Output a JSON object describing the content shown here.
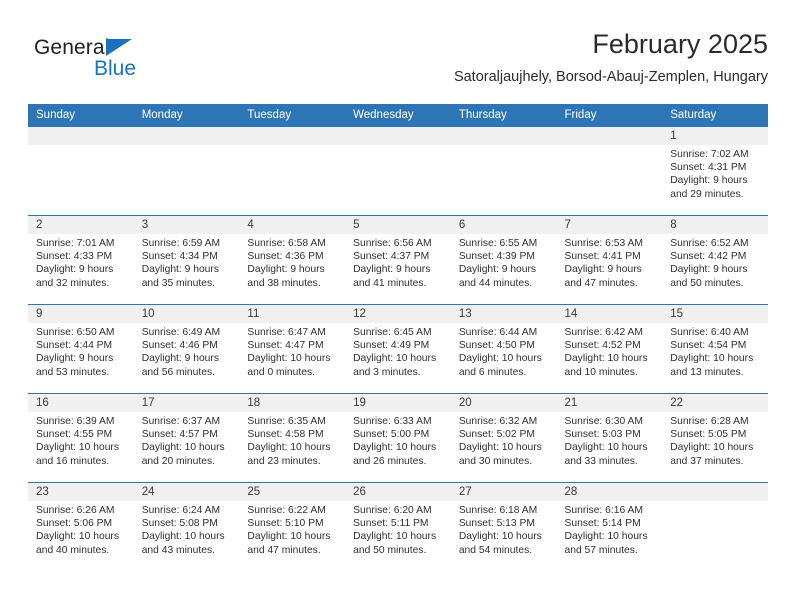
{
  "logo": {
    "word_one": "General",
    "word_two": "Blue",
    "triangle_icon": "triangle-icon",
    "brand_color": "#1a72bb"
  },
  "header": {
    "title": "February 2025",
    "subtitle": "Satoraljaujhely, Borsod-Abauj-Zemplen, Hungary"
  },
  "colors": {
    "header_blue": "#2e75b6",
    "daynum_gray": "#f0f0f0",
    "text": "#303030"
  },
  "weekdays": [
    "Sunday",
    "Monday",
    "Tuesday",
    "Wednesday",
    "Thursday",
    "Friday",
    "Saturday"
  ],
  "weeks": [
    [
      {
        "day": "",
        "sunrise": "",
        "sunset": "",
        "daylight1": "",
        "daylight2": ""
      },
      {
        "day": "",
        "sunrise": "",
        "sunset": "",
        "daylight1": "",
        "daylight2": ""
      },
      {
        "day": "",
        "sunrise": "",
        "sunset": "",
        "daylight1": "",
        "daylight2": ""
      },
      {
        "day": "",
        "sunrise": "",
        "sunset": "",
        "daylight1": "",
        "daylight2": ""
      },
      {
        "day": "",
        "sunrise": "",
        "sunset": "",
        "daylight1": "",
        "daylight2": ""
      },
      {
        "day": "",
        "sunrise": "",
        "sunset": "",
        "daylight1": "",
        "daylight2": ""
      },
      {
        "day": "1",
        "sunrise": "Sunrise: 7:02 AM",
        "sunset": "Sunset: 4:31 PM",
        "daylight1": "Daylight: 9 hours",
        "daylight2": "and 29 minutes."
      }
    ],
    [
      {
        "day": "2",
        "sunrise": "Sunrise: 7:01 AM",
        "sunset": "Sunset: 4:33 PM",
        "daylight1": "Daylight: 9 hours",
        "daylight2": "and 32 minutes."
      },
      {
        "day": "3",
        "sunrise": "Sunrise: 6:59 AM",
        "sunset": "Sunset: 4:34 PM",
        "daylight1": "Daylight: 9 hours",
        "daylight2": "and 35 minutes."
      },
      {
        "day": "4",
        "sunrise": "Sunrise: 6:58 AM",
        "sunset": "Sunset: 4:36 PM",
        "daylight1": "Daylight: 9 hours",
        "daylight2": "and 38 minutes."
      },
      {
        "day": "5",
        "sunrise": "Sunrise: 6:56 AM",
        "sunset": "Sunset: 4:37 PM",
        "daylight1": "Daylight: 9 hours",
        "daylight2": "and 41 minutes."
      },
      {
        "day": "6",
        "sunrise": "Sunrise: 6:55 AM",
        "sunset": "Sunset: 4:39 PM",
        "daylight1": "Daylight: 9 hours",
        "daylight2": "and 44 minutes."
      },
      {
        "day": "7",
        "sunrise": "Sunrise: 6:53 AM",
        "sunset": "Sunset: 4:41 PM",
        "daylight1": "Daylight: 9 hours",
        "daylight2": "and 47 minutes."
      },
      {
        "day": "8",
        "sunrise": "Sunrise: 6:52 AM",
        "sunset": "Sunset: 4:42 PM",
        "daylight1": "Daylight: 9 hours",
        "daylight2": "and 50 minutes."
      }
    ],
    [
      {
        "day": "9",
        "sunrise": "Sunrise: 6:50 AM",
        "sunset": "Sunset: 4:44 PM",
        "daylight1": "Daylight: 9 hours",
        "daylight2": "and 53 minutes."
      },
      {
        "day": "10",
        "sunrise": "Sunrise: 6:49 AM",
        "sunset": "Sunset: 4:46 PM",
        "daylight1": "Daylight: 9 hours",
        "daylight2": "and 56 minutes."
      },
      {
        "day": "11",
        "sunrise": "Sunrise: 6:47 AM",
        "sunset": "Sunset: 4:47 PM",
        "daylight1": "Daylight: 10 hours",
        "daylight2": "and 0 minutes."
      },
      {
        "day": "12",
        "sunrise": "Sunrise: 6:45 AM",
        "sunset": "Sunset: 4:49 PM",
        "daylight1": "Daylight: 10 hours",
        "daylight2": "and 3 minutes."
      },
      {
        "day": "13",
        "sunrise": "Sunrise: 6:44 AM",
        "sunset": "Sunset: 4:50 PM",
        "daylight1": "Daylight: 10 hours",
        "daylight2": "and 6 minutes."
      },
      {
        "day": "14",
        "sunrise": "Sunrise: 6:42 AM",
        "sunset": "Sunset: 4:52 PM",
        "daylight1": "Daylight: 10 hours",
        "daylight2": "and 10 minutes."
      },
      {
        "day": "15",
        "sunrise": "Sunrise: 6:40 AM",
        "sunset": "Sunset: 4:54 PM",
        "daylight1": "Daylight: 10 hours",
        "daylight2": "and 13 minutes."
      }
    ],
    [
      {
        "day": "16",
        "sunrise": "Sunrise: 6:39 AM",
        "sunset": "Sunset: 4:55 PM",
        "daylight1": "Daylight: 10 hours",
        "daylight2": "and 16 minutes."
      },
      {
        "day": "17",
        "sunrise": "Sunrise: 6:37 AM",
        "sunset": "Sunset: 4:57 PM",
        "daylight1": "Daylight: 10 hours",
        "daylight2": "and 20 minutes."
      },
      {
        "day": "18",
        "sunrise": "Sunrise: 6:35 AM",
        "sunset": "Sunset: 4:58 PM",
        "daylight1": "Daylight: 10 hours",
        "daylight2": "and 23 minutes."
      },
      {
        "day": "19",
        "sunrise": "Sunrise: 6:33 AM",
        "sunset": "Sunset: 5:00 PM",
        "daylight1": "Daylight: 10 hours",
        "daylight2": "and 26 minutes."
      },
      {
        "day": "20",
        "sunrise": "Sunrise: 6:32 AM",
        "sunset": "Sunset: 5:02 PM",
        "daylight1": "Daylight: 10 hours",
        "daylight2": "and 30 minutes."
      },
      {
        "day": "21",
        "sunrise": "Sunrise: 6:30 AM",
        "sunset": "Sunset: 5:03 PM",
        "daylight1": "Daylight: 10 hours",
        "daylight2": "and 33 minutes."
      },
      {
        "day": "22",
        "sunrise": "Sunrise: 6:28 AM",
        "sunset": "Sunset: 5:05 PM",
        "daylight1": "Daylight: 10 hours",
        "daylight2": "and 37 minutes."
      }
    ],
    [
      {
        "day": "23",
        "sunrise": "Sunrise: 6:26 AM",
        "sunset": "Sunset: 5:06 PM",
        "daylight1": "Daylight: 10 hours",
        "daylight2": "and 40 minutes."
      },
      {
        "day": "24",
        "sunrise": "Sunrise: 6:24 AM",
        "sunset": "Sunset: 5:08 PM",
        "daylight1": "Daylight: 10 hours",
        "daylight2": "and 43 minutes."
      },
      {
        "day": "25",
        "sunrise": "Sunrise: 6:22 AM",
        "sunset": "Sunset: 5:10 PM",
        "daylight1": "Daylight: 10 hours",
        "daylight2": "and 47 minutes."
      },
      {
        "day": "26",
        "sunrise": "Sunrise: 6:20 AM",
        "sunset": "Sunset: 5:11 PM",
        "daylight1": "Daylight: 10 hours",
        "daylight2": "and 50 minutes."
      },
      {
        "day": "27",
        "sunrise": "Sunrise: 6:18 AM",
        "sunset": "Sunset: 5:13 PM",
        "daylight1": "Daylight: 10 hours",
        "daylight2": "and 54 minutes."
      },
      {
        "day": "28",
        "sunrise": "Sunrise: 6:16 AM",
        "sunset": "Sunset: 5:14 PM",
        "daylight1": "Daylight: 10 hours",
        "daylight2": "and 57 minutes."
      },
      {
        "day": "",
        "sunrise": "",
        "sunset": "",
        "daylight1": "",
        "daylight2": ""
      }
    ]
  ]
}
